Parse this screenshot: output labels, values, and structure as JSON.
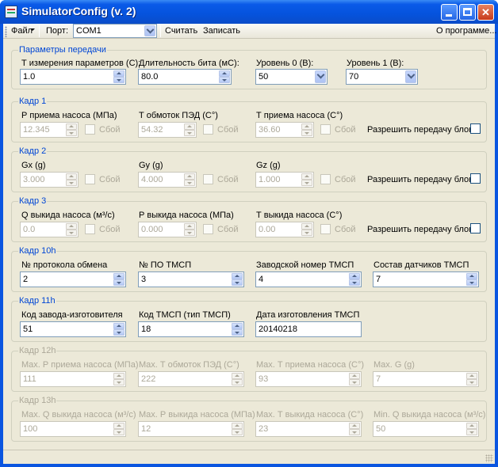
{
  "window": {
    "title": "SimulatorConfig (v. 2)"
  },
  "menu": {
    "file": "Файл",
    "port_label": "Порт:",
    "port_value": "COM1",
    "read": "Считать",
    "write": "Записать",
    "about": "О программе..."
  },
  "transfer": {
    "title": "Параметры передачи",
    "t_label": "Т измерения параметров (С):",
    "t_value": "1.0",
    "bit_label": "Длительность бита (мС):",
    "bit_value": "80.0",
    "level0_label": "Уровень 0 (В):",
    "level0_value": "50",
    "level1_label": "Уровень 1 (В):",
    "level1_value": "70"
  },
  "fault_label": "Сбой",
  "allow_label": "Разрешить передачу блока",
  "frame1": {
    "title": "Кадр 1",
    "f1_label": "Р приема насоса (МПа)",
    "f1_value": "12.345",
    "f2_label": "Т обмоток ПЭД (С°)",
    "f2_value": "54.32",
    "f3_label": "Т приема насоса (С°)",
    "f3_value": "36.60"
  },
  "frame2": {
    "title": "Кадр 2",
    "f1_label": "Gx (g)",
    "f1_value": "3.000",
    "f2_label": "Gy (g)",
    "f2_value": "4.000",
    "f3_label": "Gz (g)",
    "f3_value": "1.000"
  },
  "frame3": {
    "title": "Кадр 3",
    "f1_label": "Q выкида насоса (м³/с)",
    "f1_value": "0.0",
    "f2_label": "Р выкида насоса (МПа)",
    "f2_value": "0.000",
    "f3_label": "Т выкида насоса (С°)",
    "f3_value": "0.00"
  },
  "frame10h": {
    "title": "Кадр 10h",
    "f1_label": "№ протокола обмена",
    "f1_value": "2",
    "f2_label": "№ ПО ТМСП",
    "f2_value": "3",
    "f3_label": "Заводской номер ТМСП",
    "f3_value": "4",
    "f4_label": "Состав датчиков ТМСП",
    "f4_value": "7"
  },
  "frame11h": {
    "title": "Кадр 11h",
    "f1_label": "Код завода-изготовителя",
    "f1_value": "51",
    "f2_label": "Код ТМСП (тип ТМСП)",
    "f2_value": "18",
    "f3_label": "Дата изготовления ТМСП",
    "f3_value": "20140218"
  },
  "frame12h": {
    "title": "Кадр 12h",
    "f1_label": "Max. Р приема насоса (МПа)",
    "f1_value": "111",
    "f2_label": "Max. Т обмоток ПЭД (С°)",
    "f2_value": "222",
    "f3_label": "Max. Т приема насоса (С°)",
    "f3_value": "93",
    "f4_label": "Max. G (g)",
    "f4_value": "7"
  },
  "frame13h": {
    "title": "Кадр 13h",
    "f1_label": "Max. Q выкида насоса (м³/с)",
    "f1_value": "100",
    "f2_label": "Max. Р выкида насоса (МПа)",
    "f2_value": "12",
    "f3_label": "Max. Т выкида насоса (С°)",
    "f3_value": "23",
    "f4_label": "Min. Q выкида насоса (м³/с)",
    "f4_value": "50"
  }
}
